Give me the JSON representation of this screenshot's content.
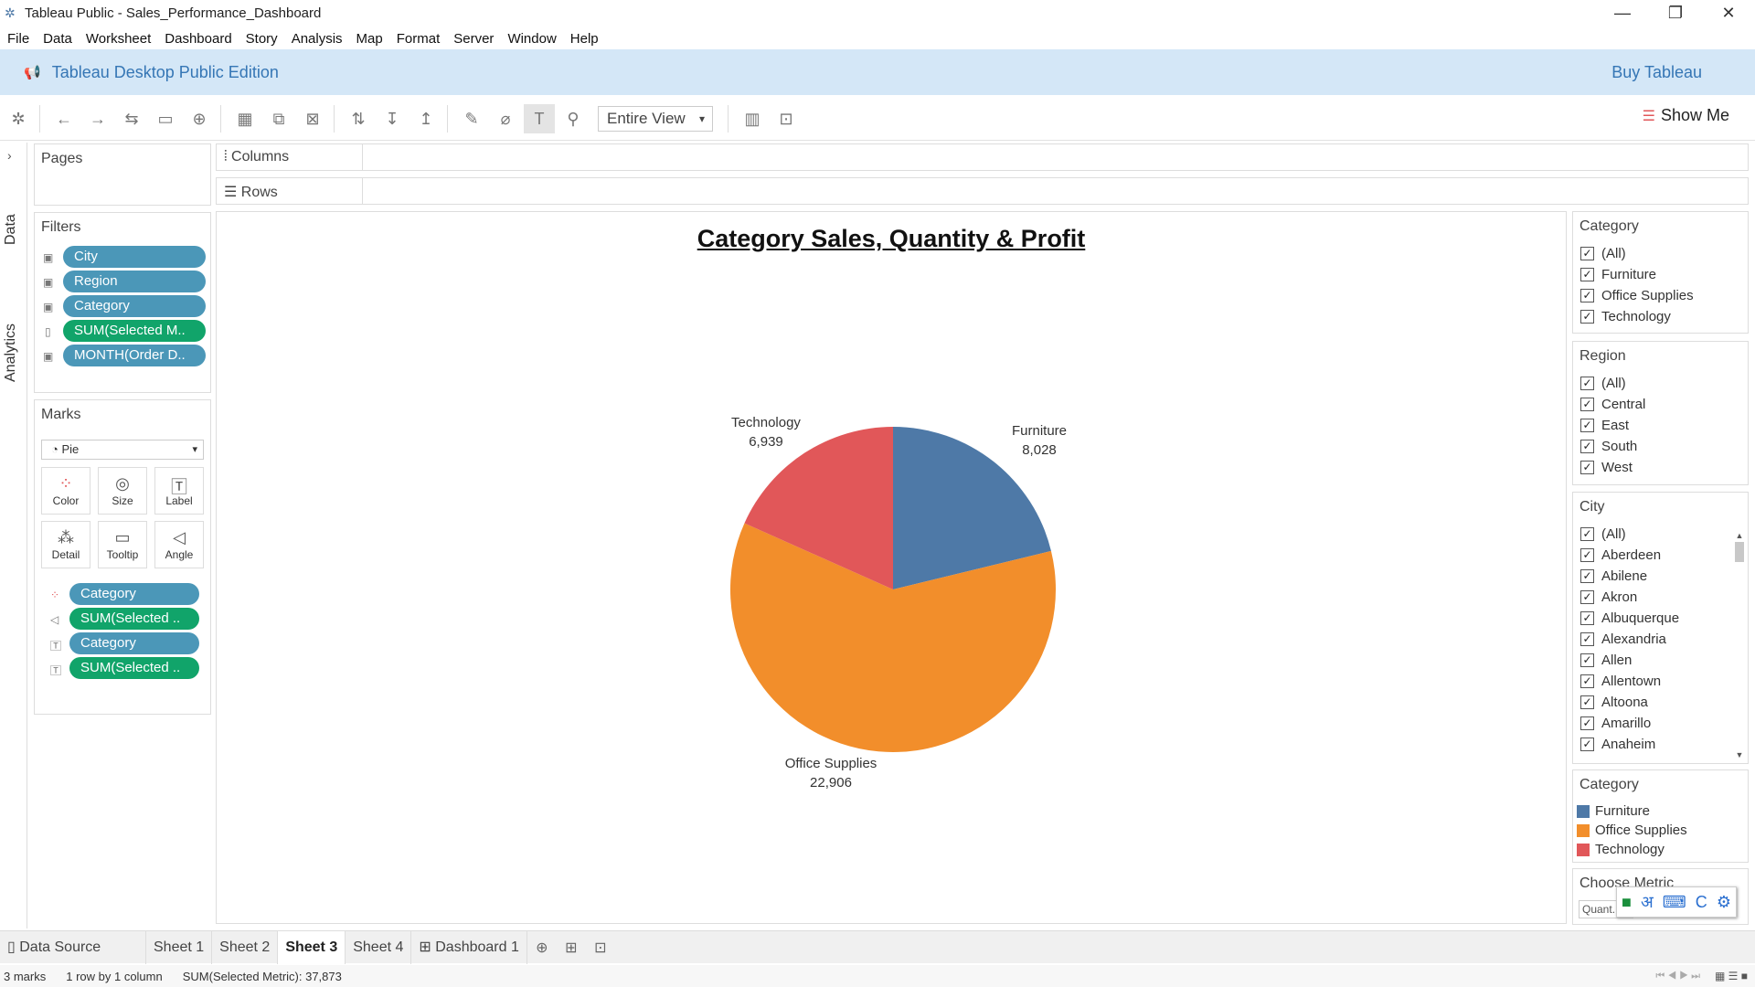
{
  "window": {
    "title": "Tableau Public - Sales_Performance_Dashboard",
    "minimize": "—",
    "restore": "❐",
    "close": "✕"
  },
  "menu": [
    "File",
    "Data",
    "Worksheet",
    "Dashboard",
    "Story",
    "Analysis",
    "Map",
    "Format",
    "Server",
    "Window",
    "Help"
  ],
  "banner": {
    "edition": "Tableau Desktop Public Edition",
    "buy": "Buy Tableau"
  },
  "toolbar": {
    "fit": "Entire View",
    "show_me": "Show Me"
  },
  "side_tabs": {
    "data": "Data",
    "analytics": "Analytics"
  },
  "pages": {
    "title": "Pages"
  },
  "filters": {
    "title": "Filters",
    "items": [
      "City",
      "Region",
      "Category",
      "SUM(Selected M..",
      "MONTH(Order D.."
    ]
  },
  "marks": {
    "title": "Marks",
    "type": "Pie",
    "buttons": [
      "Color",
      "Size",
      "Label",
      "Detail",
      "Tooltip",
      "Angle"
    ],
    "pills": [
      "Category",
      "SUM(Selected ..",
      "Category",
      "SUM(Selected .."
    ]
  },
  "shelves": {
    "columns": "Columns",
    "rows": "Rows"
  },
  "chart_data": {
    "type": "pie",
    "title": "Category Sales, Quantity & Profit",
    "categories": [
      "Furniture",
      "Office Supplies",
      "Technology"
    ],
    "values": [
      8028,
      22906,
      6939
    ],
    "value_labels": [
      "8,028",
      "22,906",
      "6,939"
    ],
    "colors": [
      "#4e79a7",
      "#f28e2b",
      "#e15759"
    ]
  },
  "category_filter": {
    "title": "Category",
    "items": [
      "(All)",
      "Furniture",
      "Office Supplies",
      "Technology"
    ]
  },
  "region_filter": {
    "title": "Region",
    "items": [
      "(All)",
      "Central",
      "East",
      "South",
      "West"
    ]
  },
  "city_filter": {
    "title": "City",
    "items": [
      "(All)",
      "Aberdeen",
      "Abilene",
      "Akron",
      "Albuquerque",
      "Alexandria",
      "Allen",
      "Allentown",
      "Altoona",
      "Amarillo",
      "Anaheim"
    ]
  },
  "legend": {
    "title": "Category",
    "items": [
      {
        "label": "Furniture",
        "color": "#4e79a7"
      },
      {
        "label": "Office Supplies",
        "color": "#f28e2b"
      },
      {
        "label": "Technology",
        "color": "#e15759"
      }
    ]
  },
  "metric": {
    "title": "Choose Metric",
    "value": "Quant..."
  },
  "sheet_tabs": {
    "data_source": "Data Source",
    "sheets": [
      "Sheet 1",
      "Sheet 2",
      "Sheet 3",
      "Sheet 4",
      "Dashboard 1"
    ],
    "active": "Sheet 3"
  },
  "status": {
    "marks": "3 marks",
    "rows_cols": "1 row by 1 column",
    "sum": "SUM(Selected Metric): 37,873"
  }
}
